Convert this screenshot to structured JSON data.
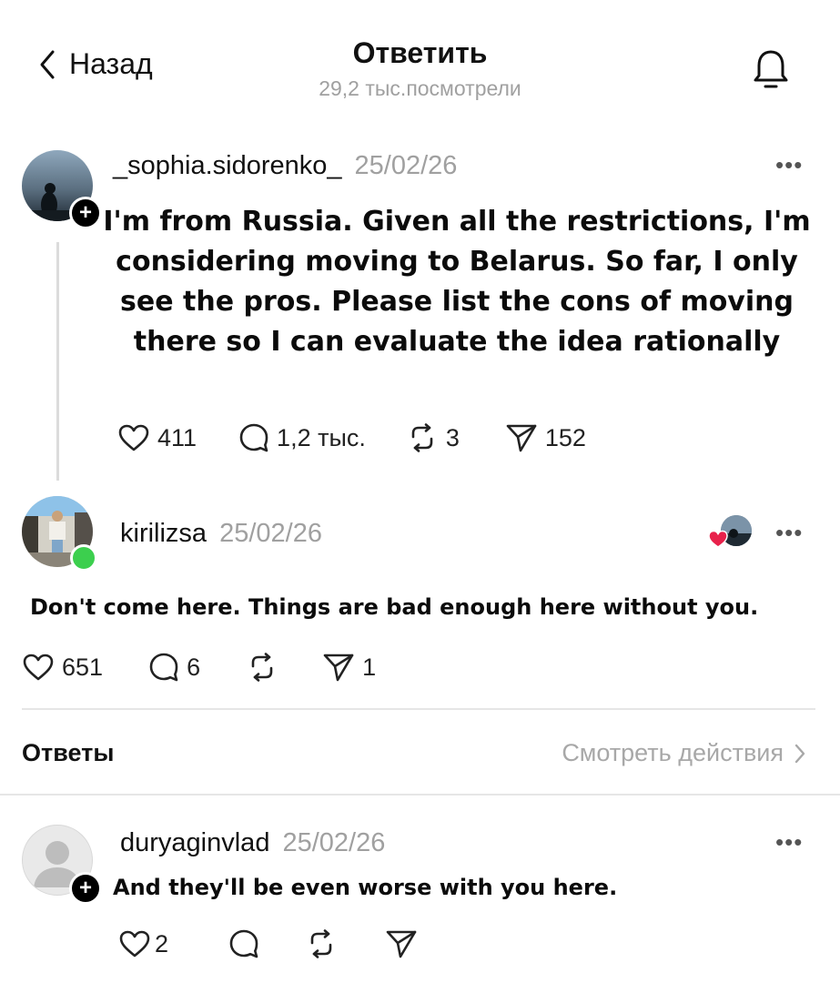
{
  "header": {
    "back_label": "Назад",
    "title": "Ответить",
    "views": "29,2 тыс.посмотрели"
  },
  "original_post": {
    "username": "_sophia.sidorenko_",
    "date": "25/02/26",
    "text": "I'm from Russia. Given all the restrictions, I'm considering moving to Belarus. So far, I only see the pros. Please list the cons of moving there so I can evaluate the idea rationally",
    "likes": "411",
    "comments": "1,2 тыс.",
    "reposts": "3",
    "shares": "152"
  },
  "reply": {
    "username": "kirilizsa",
    "date": "25/02/26",
    "text": "Don't come here. Things are bad enough here without you.",
    "likes": "651",
    "comments": "6",
    "shares": "1"
  },
  "replies_section": {
    "title": "Ответы",
    "view_activity": "Смотреть действия"
  },
  "sub_reply": {
    "username": "duryaginvlad",
    "date": "25/02/26",
    "text": "And they'll be even worse with you here.",
    "likes": "2"
  },
  "colors": {
    "online_green": "#3ccf4e",
    "heart_red": "#e8214b",
    "divider": "#e6e6e6",
    "thread_line": "#dcdcdc"
  }
}
